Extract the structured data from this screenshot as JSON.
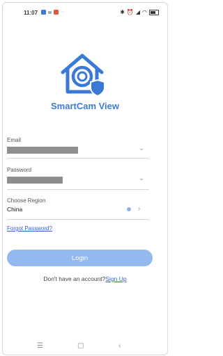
{
  "status_bar": {
    "time": "11:07",
    "dots": "··"
  },
  "app": {
    "name": "SmartCam View",
    "brand_color": "#3a79d6"
  },
  "form": {
    "email_label": "Email",
    "password_label": "Password",
    "region_label": "Choose Region",
    "region_value": "China",
    "forgot_password": "Forgot Password?",
    "login_button": "Login",
    "no_account_text": "Don't have an account?",
    "sign_up_link": "Sign Up"
  },
  "icons": {
    "email_dropdown": "chevron-down-icon",
    "password_dropdown": "chevron-down-icon",
    "region_chevron": "chevron-right-icon",
    "nav": [
      "menu-icon",
      "home-square-icon",
      "back-icon"
    ]
  }
}
